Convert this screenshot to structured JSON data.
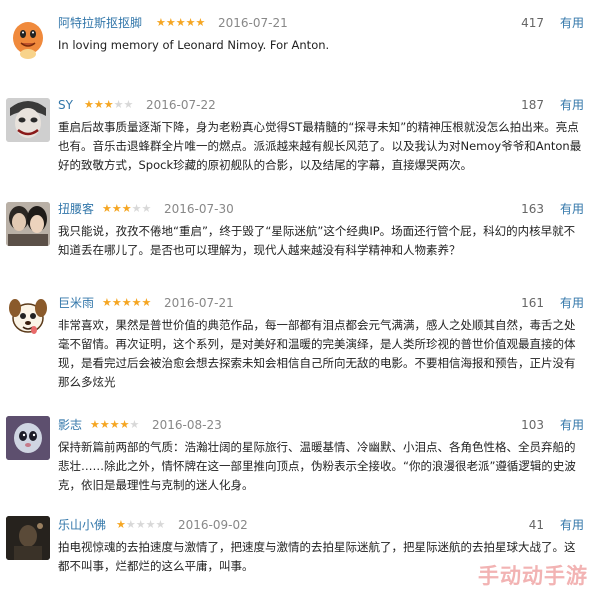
{
  "useful_label": "有用",
  "reviews": [
    {
      "user": "阿特拉斯抠抠脚",
      "rating": 5,
      "date": "2016-07-21",
      "votes": "417",
      "text": "In loving memory of Leonard Nimoy. For Anton.",
      "avatar": "charmander-avatar"
    },
    {
      "user": "SY",
      "rating": 3,
      "date": "2016-07-22",
      "votes": "187",
      "text": "重启后故事质量逐渐下降，身为老粉真心觉得ST最精髓的“探寻未知”的精神压根就没怎么拍出来。亮点也有。音乐击退蜂群全片唯一的燃点。派派越来越有舰长风范了。以及我认为对Nemoy爷爷和Anton最好的致敬方式，Spock珍藏的原初舰队的合影，以及结尾的字幕，直接爆哭两次。",
      "avatar": "joker-avatar"
    },
    {
      "user": "扭腰客",
      "rating": 3,
      "date": "2016-07-30",
      "votes": "163",
      "text": "我只能说，孜孜不倦地“重启”，终于毁了“星际迷航”这个经典IP。场面还行管个屁，科幻的内核早就不知道丢在哪儿了。是否也可以理解为，现代人越来越没有科学精神和人物素养？",
      "avatar": "couple-avatar"
    },
    {
      "user": "巨米雨",
      "rating": 5,
      "date": "2016-07-21",
      "votes": "161",
      "text": "非常喜欢，果然是普世价值的典范作品，每一部都有泪点都会元气满满，感人之处顺其自然，毒舌之处毫不留情。再次证明，这个系列，是对美好和温暖的完美演绎，是人类所珍视的普世价值观最直接的体现，是看完过后会被治愈会想去探索未知会相信自己所向无敌的电影。不要相信海报和预告，正片没有那么多炫光",
      "avatar": "dog-avatar"
    },
    {
      "user": "影志",
      "rating": 4,
      "date": "2016-08-23",
      "votes": "103",
      "text": "保持新篇前两部的气质：浩瀚壮阔的星际旅行、温暖基情、冷幽默、小泪点、各角色性格、全员弃船的悲壮……除此之外，情怀牌在这一部里推向顶点，伪粉表示全接收。“你的浪漫很老派”遵循逻辑的史波克，依旧是最理性与克制的迷人化身。",
      "avatar": "ghost-avatar"
    },
    {
      "user": "乐山小佛",
      "rating": 1,
      "date": "2016-09-02",
      "votes": "41",
      "text": "拍电视惊魂的去拍速度与激情了，把速度与激情的去拍星际迷航了，把星际迷航的去拍星球大战了。这都不叫事，烂都烂的这么平庸，叫事。",
      "avatar": "dark-avatar"
    }
  ],
  "watermark": "手动动手游"
}
